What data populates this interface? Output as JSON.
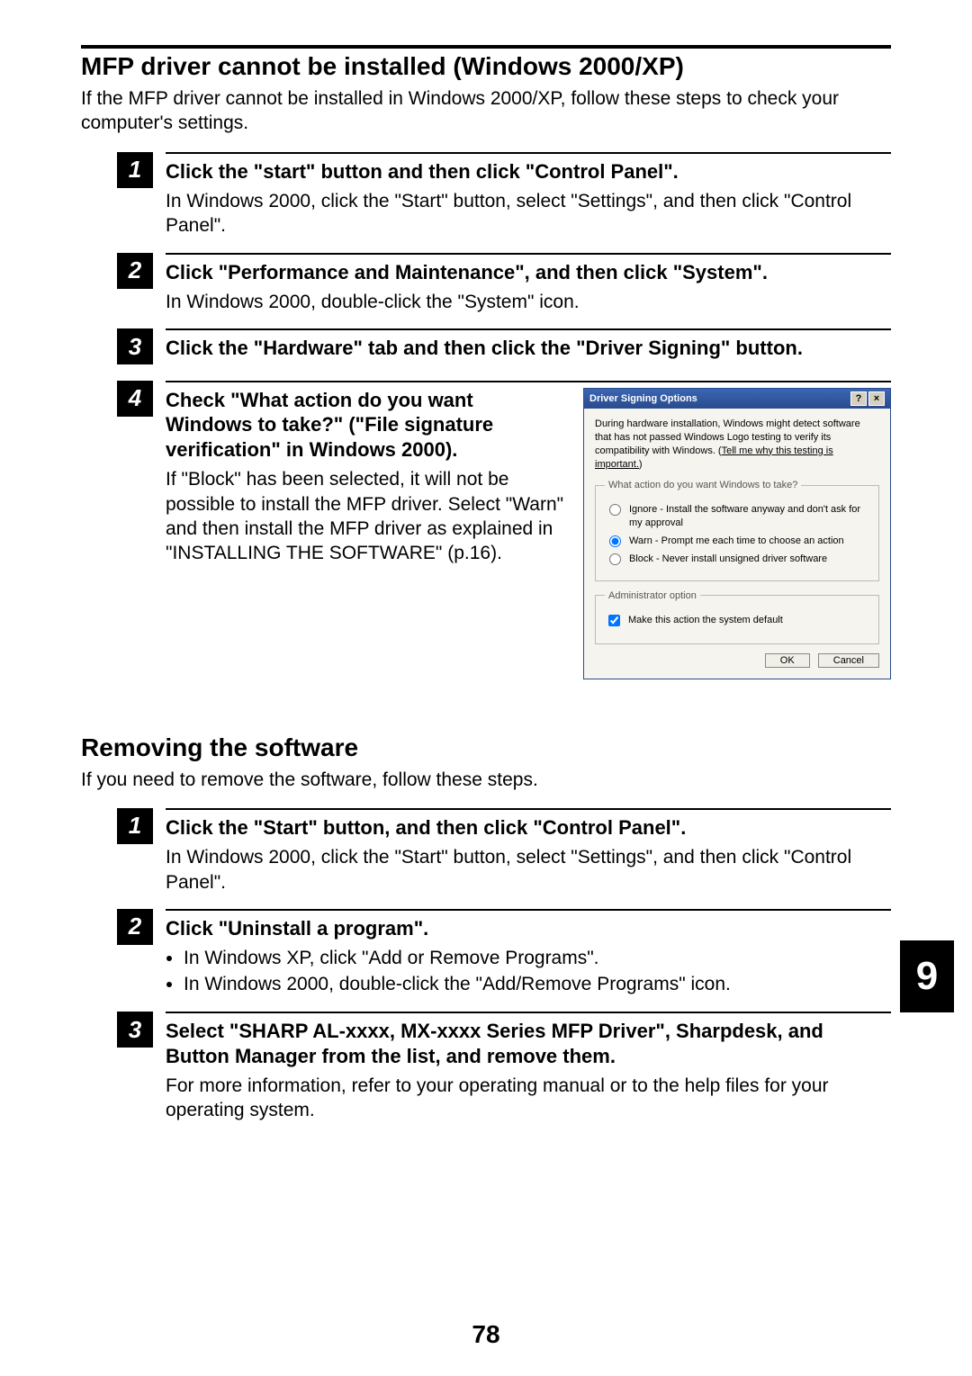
{
  "page_number": "78",
  "side_tab": "9",
  "section1": {
    "title": "MFP driver cannot be installed (Windows 2000/XP)",
    "intro": "If the MFP driver cannot be installed in Windows 2000/XP, follow these steps to check your computer's settings.",
    "steps": [
      {
        "num": "1",
        "title": "Click the \"start\" button and then click \"Control Panel\".",
        "desc": "In Windows 2000, click the \"Start\" button, select \"Settings\", and then click \"Control Panel\"."
      },
      {
        "num": "2",
        "title": "Click \"Performance and Maintenance\", and then click \"System\".",
        "desc": "In Windows 2000, double-click the \"System\" icon."
      },
      {
        "num": "3",
        "title": "Click the \"Hardware\" tab and then click the \"Driver Signing\" button.",
        "desc": ""
      },
      {
        "num": "4",
        "title": "Check \"What action do you want Windows to take?\" (\"File signature verification\" in Windows 2000).",
        "desc": "If \"Block\" has been selected, it will not be possible to install the MFP driver. Select \"Warn\" and then install the MFP driver as explained in \"INSTALLING THE SOFTWARE\" (p.16)."
      }
    ]
  },
  "dialog": {
    "title": "Driver Signing Options",
    "text_a": "During hardware installation, Windows might detect software that has not passed Windows Logo testing to verify its compatibility with Windows. (",
    "link": "Tell me why this testing is important.",
    "text_b": ")",
    "group1": "What action do you want Windows to take?",
    "opt_ignore": "Ignore - Install the software anyway and don't ask for my approval",
    "opt_warn": "Warn - Prompt me each time to choose an action",
    "opt_block": "Block - Never install unsigned driver software",
    "group2": "Administrator option",
    "admin_opt": "Make this action the system default",
    "ok": "OK",
    "cancel": "Cancel"
  },
  "section2": {
    "title": "Removing the software",
    "intro": "If you need to remove the software, follow these steps.",
    "steps": [
      {
        "num": "1",
        "title": "Click the \"Start\" button, and then click \"Control Panel\".",
        "desc": "In Windows 2000, click the \"Start\" button, select \"Settings\", and then click \"Control Panel\"."
      },
      {
        "num": "2",
        "title": "Click \"Uninstall a program\".",
        "bullets": [
          "In Windows XP, click \"Add or Remove Programs\".",
          "In Windows 2000, double-click the \"Add/Remove Programs\" icon."
        ]
      },
      {
        "num": "3",
        "title": "Select \"SHARP AL-xxxx, MX-xxxx Series MFP Driver\", Sharpdesk, and Button Manager from the list, and remove them.",
        "desc": "For more information, refer to your operating manual or to the help files for your operating system."
      }
    ]
  }
}
